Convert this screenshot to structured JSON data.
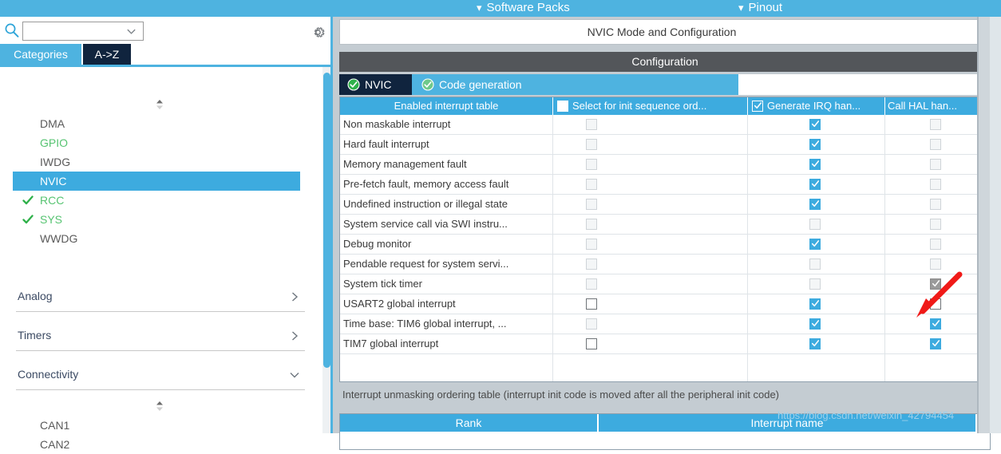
{
  "ribbon": {
    "items": [
      {
        "label": "Software Packs",
        "icon": "chevron-down-icon"
      },
      {
        "label": "Pinout",
        "icon": "chevron-down-icon"
      }
    ]
  },
  "left_panel": {
    "search": {
      "value": "",
      "placeholder": "",
      "icon": "search-icon"
    },
    "settings_icon": "gear-icon",
    "tabs": [
      {
        "label": "Categories",
        "selected": false
      },
      {
        "label": "A->Z",
        "selected": true
      }
    ],
    "peripherals": [
      {
        "label": "DMA",
        "state": "normal",
        "selected": false
      },
      {
        "label": "GPIO",
        "state": "configured",
        "selected": false
      },
      {
        "label": "IWDG",
        "state": "normal",
        "selected": false
      },
      {
        "label": "NVIC",
        "state": "normal",
        "selected": true
      },
      {
        "label": "RCC",
        "state": "checked",
        "selected": false
      },
      {
        "label": "SYS",
        "state": "checked",
        "selected": false
      },
      {
        "label": "WWDG",
        "state": "normal",
        "selected": false
      }
    ],
    "categories": [
      {
        "label": "Analog",
        "expanded": false
      },
      {
        "label": "Timers",
        "expanded": false
      },
      {
        "label": "Connectivity",
        "expanded": true
      }
    ],
    "connectivity_items": [
      {
        "label": "CAN1"
      },
      {
        "label": "CAN2"
      }
    ]
  },
  "right_panel": {
    "mode_header": "NVIC Mode and Configuration",
    "configuration_bar": "Configuration",
    "tabs": [
      {
        "label": "NVIC",
        "icon": "check-circle-icon",
        "selected": true
      },
      {
        "label": "Code generation",
        "icon": "check-circle-icon",
        "selected": false
      }
    ],
    "table": {
      "columns": [
        {
          "label": "Enabled interrupt table",
          "checkbox": null
        },
        {
          "label": "Select for init sequence ord...",
          "checkbox": "unchecked"
        },
        {
          "label": "Generate IRQ han...",
          "checkbox": "checked"
        },
        {
          "label": "Call HAL han...",
          "checkbox": null
        }
      ],
      "rows": [
        {
          "name": "Non maskable interrupt",
          "select": "off-disabled",
          "irq": "on",
          "hal": "off-disabled"
        },
        {
          "name": "Hard fault interrupt",
          "select": "off-disabled",
          "irq": "on",
          "hal": "off-disabled"
        },
        {
          "name": "Memory management fault",
          "select": "off-disabled",
          "irq": "on",
          "hal": "off-disabled"
        },
        {
          "name": "Pre-fetch fault, memory access fault",
          "select": "off-disabled",
          "irq": "on",
          "hal": "off-disabled"
        },
        {
          "name": "Undefined instruction or illegal state",
          "select": "off-disabled",
          "irq": "on",
          "hal": "off-disabled"
        },
        {
          "name": "System service call via SWI instru...",
          "select": "off-disabled",
          "irq": "off-disabled",
          "hal": "off-disabled"
        },
        {
          "name": "Debug monitor",
          "select": "off-disabled",
          "irq": "on",
          "hal": "off-disabled"
        },
        {
          "name": "Pendable request for system servi...",
          "select": "off-disabled",
          "irq": "off-disabled",
          "hal": "off-disabled"
        },
        {
          "name": "System tick timer",
          "select": "off-disabled",
          "irq": "off-disabled",
          "hal": "on-disabled"
        },
        {
          "name": "USART2 global interrupt",
          "select": "off-active",
          "irq": "on",
          "hal": "off-active"
        },
        {
          "name": "Time base: TIM6 global interrupt, ...",
          "select": "off-disabled",
          "irq": "on",
          "hal": "on"
        },
        {
          "name": "TIM7 global interrupt",
          "select": "off-active",
          "irq": "on",
          "hal": "on"
        }
      ]
    },
    "note": "Interrupt unmasking ordering table (interrupt init code is moved after all the peripheral init code)",
    "rank_table": {
      "columns": [
        "Rank",
        "Interrupt name"
      ]
    }
  },
  "annotation": {
    "type": "red-arrow",
    "points_to": "USART2 global interrupt Call HAL handler checkbox"
  },
  "watermark": "https://blog.csdn.net/weixin_42794454",
  "colors": {
    "accent_blue": "#4eb3e0",
    "table_header_blue": "#3dabdf",
    "dark_tab": "#10243e",
    "config_grey": "#53565a",
    "green_check": "#2fb14a",
    "annotation_red": "#f01a18"
  }
}
